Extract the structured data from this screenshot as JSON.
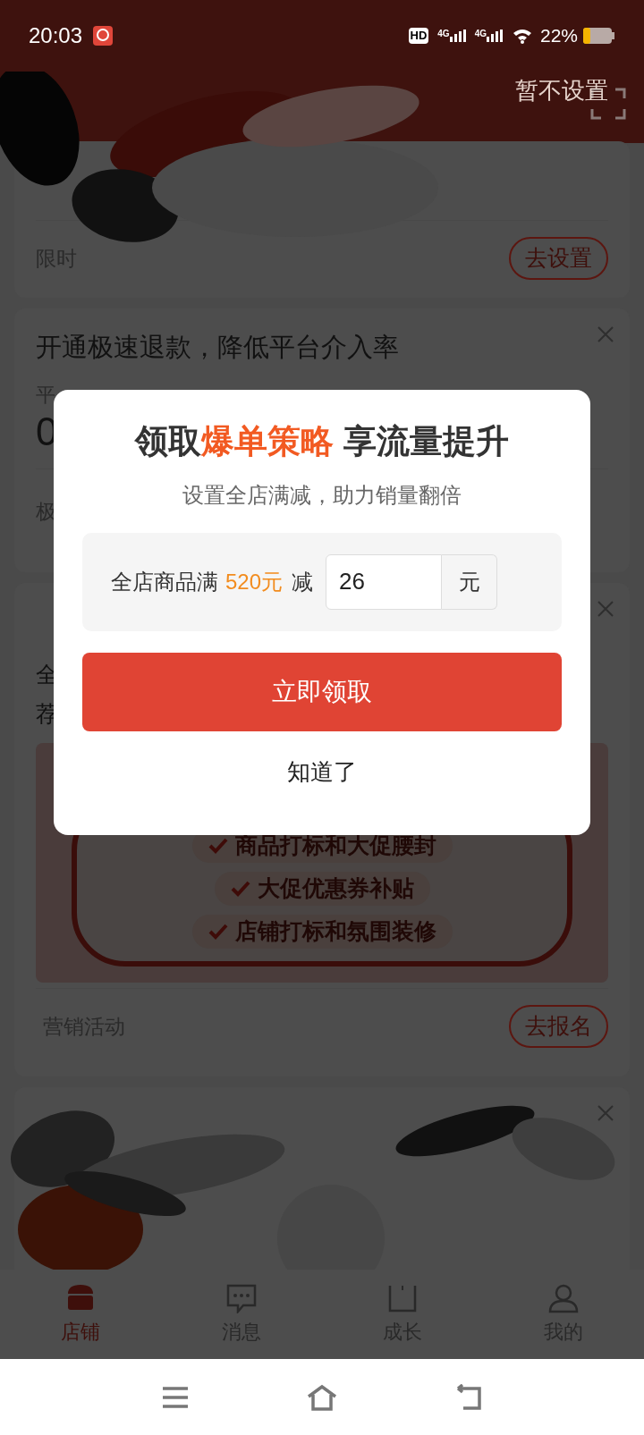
{
  "status_bar": {
    "time": "20:03",
    "hd": "HD",
    "network": [
      "4G",
      "4G"
    ],
    "battery": "22%"
  },
  "header": {
    "skip_link": "暂不设置"
  },
  "cards": [
    {
      "kind": "setting",
      "label": "限时",
      "button": "去设置",
      "closable": false
    },
    {
      "kind": "refund",
      "title": "开通极速退款，降低平台介入率",
      "fragments": [
        "平",
        "0",
        "极"
      ],
      "closable": true
    },
    {
      "kind": "promo",
      "fragments": [
        "全",
        "荐"
      ],
      "checklist": [
        "商品打标和大促腰封",
        "大促优惠券补贴",
        "店铺打标和氛围装修"
      ],
      "label": "营销活动",
      "button": "去报名",
      "closable": true
    },
    {
      "kind": "hidden",
      "closable": true
    }
  ],
  "dialog": {
    "title": [
      {
        "text": "领取",
        "highlight": false
      },
      {
        "text": "爆单策略",
        "highlight": true
      },
      {
        "text": " 享流量提升",
        "highlight": false
      }
    ],
    "subtitle": "设置全店满减，助力销量翻倍",
    "form": {
      "prefix": "全店商品满",
      "threshold": "520元",
      "middle": "减",
      "value": "26",
      "unit": "元"
    },
    "primary_button": "立即领取",
    "dismiss": "知道了"
  },
  "tab_bar": [
    {
      "label": "店铺",
      "kind": "shop",
      "selected": true
    },
    {
      "label": "消息",
      "kind": "chat",
      "selected": false
    },
    {
      "label": "成长",
      "kind": "book",
      "selected": false
    },
    {
      "label": "我的",
      "kind": "person",
      "selected": false
    }
  ]
}
